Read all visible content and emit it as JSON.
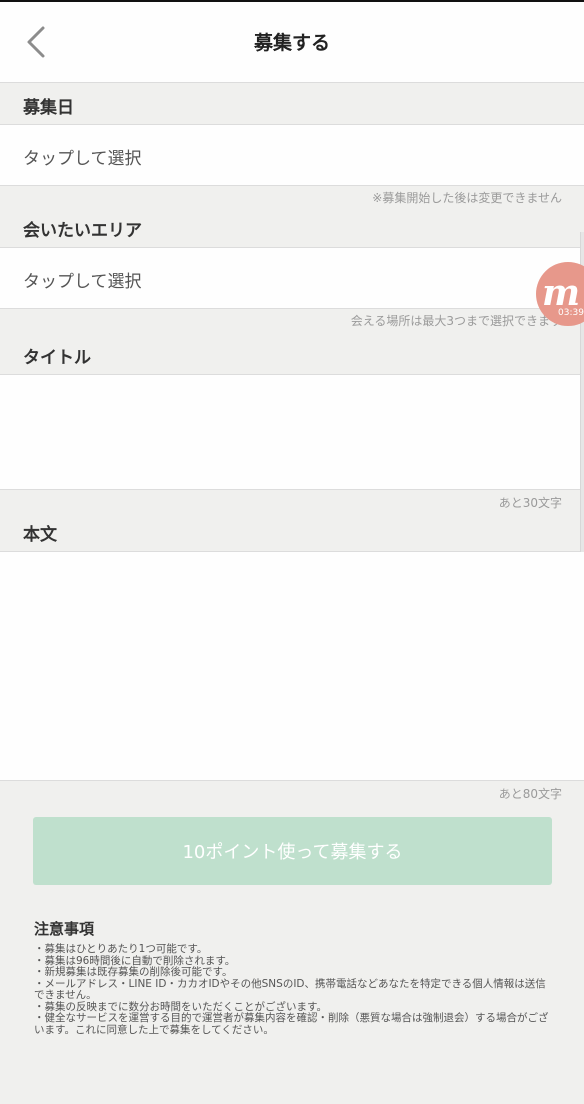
{
  "header": {
    "title": "募集する"
  },
  "recruit_date": {
    "label": "募集日",
    "select_text": "タップして選択",
    "note": "※募集開始した後は変更できません"
  },
  "area": {
    "label": "会いたいエリア",
    "select_text": "タップして選択",
    "note": "会える場所は最大3つまで選択できます"
  },
  "title_field": {
    "label": "タイトル",
    "value": "",
    "counter": "あと30文字"
  },
  "body_field": {
    "label": "本文",
    "value": "",
    "counter": "あと80文字"
  },
  "submit": {
    "label": "10ポイント使って募集する"
  },
  "notes": {
    "title": "注意事項",
    "lines": [
      "・募集はひとりあたり1つ可能です。",
      "・募集は96時間後に自動で削除されます。",
      "・新規募集は既存募集の削除後可能です。",
      "・メールアドレス・LINE ID・カカオIDやその他SNSのID、携帯電話などあなたを特定できる個人情報は送信できません。",
      "・募集の反映までに数分お時間をいただくことがございます。",
      "・健全なサービスを運営する目的で運営者が募集内容を確認・削除（悪質な場合は強制退会）する場合がございます。これに同意した上で募集をしてください。"
    ]
  },
  "floating_badge": {
    "time": "03:39",
    "letter": "m"
  },
  "colors": {
    "accent_disabled": "#bfe0cd",
    "background": "#f0f0ee",
    "badge": "#e7988b"
  },
  "icons": {
    "back": "chevron-left-icon"
  }
}
